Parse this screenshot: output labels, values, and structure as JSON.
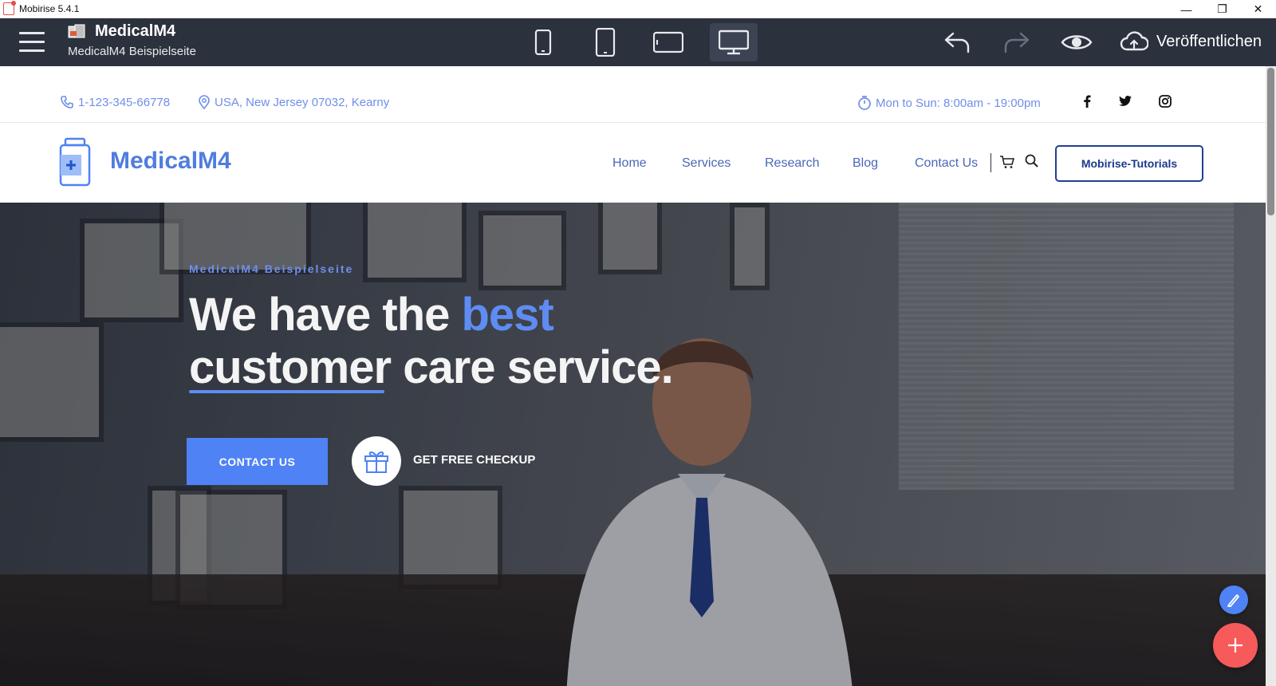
{
  "window": {
    "title": "Mobirise 5.4.1",
    "controls": [
      "minimize",
      "restore",
      "close"
    ]
  },
  "toolbar": {
    "project_name": "MedicalM4",
    "project_subtitle": "MedicalM4 Beispielseite",
    "devices": [
      "phone",
      "tablet",
      "tablet-landscape",
      "desktop"
    ],
    "active_device": "desktop",
    "publish_label": "Veröffentlichen"
  },
  "infobar": {
    "phone": "1-123-345-66778",
    "address": "USA, New Jersey 07032, Kearny",
    "hours": "Mon to Sun: 8:00am - 19:00pm",
    "social": [
      "facebook",
      "twitter",
      "instagram"
    ]
  },
  "navbar": {
    "brand": "MedicalM4",
    "links": [
      "Home",
      "Services",
      "Research",
      "Blog",
      "Contact Us"
    ],
    "cta": "Mobirise-Tutorials"
  },
  "hero": {
    "subtitle": "MedicalM4 Beispielseite",
    "title_part1": "We have the ",
    "title_accent": "best",
    "title_part2": "customer care service.",
    "primary_button": "CONTACT US",
    "secondary_link": "GET FREE CHECKUP"
  },
  "colors": {
    "accent": "#4f82f5",
    "toolbar_bg": "#2b313d",
    "fab_add": "#f75a5a",
    "link": "#6f8fe9"
  }
}
